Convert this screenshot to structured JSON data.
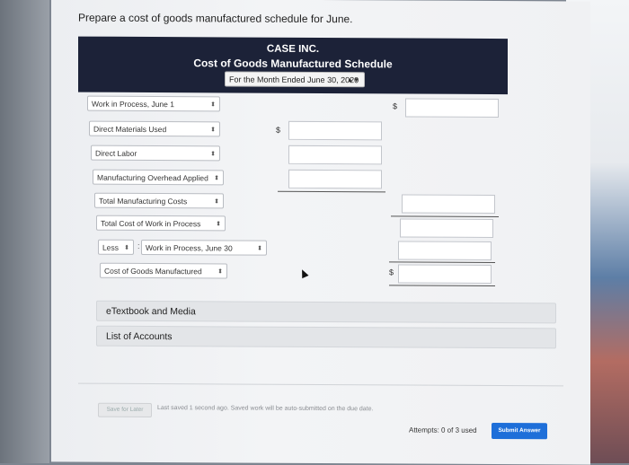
{
  "prompt": "Prepare a cost of goods manufactured schedule for June.",
  "header": {
    "company": "CASE INC.",
    "title": "Cost of Goods Manufactured Schedule",
    "period": "For the Month Ended June 30, 2020"
  },
  "rows": {
    "wip_june1": "Work in Process, June 1",
    "dm_used": "Direct Materials Used",
    "direct_labor": "Direct Labor",
    "moh_applied": "Manufacturing Overhead Applied",
    "total_mfg": "Total Manufacturing Costs",
    "total_wip": "Total Cost of Work in Process",
    "less": "Less",
    "wip_june30": "Work in Process, June 30",
    "cogm": "Cost of Goods Manufactured"
  },
  "currency_symbol": "$",
  "resources": {
    "etextbook": "eTextbook and Media",
    "accounts": "List of Accounts"
  },
  "footer": {
    "save_later": "Save for Later",
    "saved_msg": "Last saved 1 second ago.  Saved work will be auto-submitted on the due date.",
    "attempts": "Attempts: 0 of 3 used",
    "submit": "Submit Answer"
  },
  "colors": {
    "header_bg": "#1c2238",
    "submit_bg": "#1e6fd9"
  }
}
